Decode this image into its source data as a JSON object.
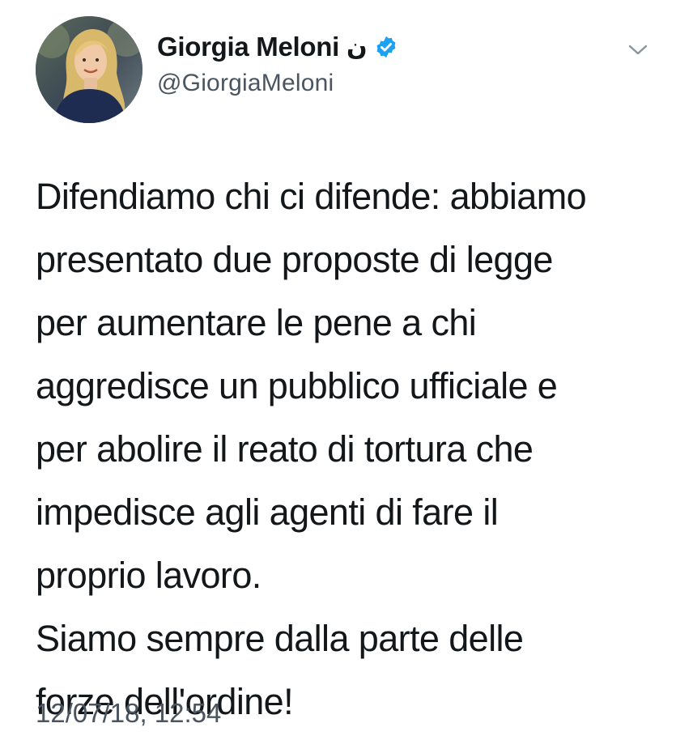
{
  "tweet": {
    "author": {
      "display_name": "Giorgia Meloni",
      "name_suffix": "ن",
      "handle": "@GiorgiaMeloni",
      "verified": true,
      "verified_icon": "verified-badge-icon",
      "verified_color": "#1da1f2"
    },
    "menu_icon": "chevron-down-icon",
    "text_lines": [
      "Difendiamo chi ci difende: abbiamo",
      "presentato due proposte di legge",
      "per aumentare le pene a chi",
      "aggredisce un pubblico ufficiale e",
      "per abolire il reato di tortura che",
      "impedisce agli agenti di fare il",
      "proprio lavoro.",
      "Siamo sempre dalla parte delle",
      "forze dell'ordine!"
    ],
    "timestamp": "12/07/18, 12:54"
  }
}
